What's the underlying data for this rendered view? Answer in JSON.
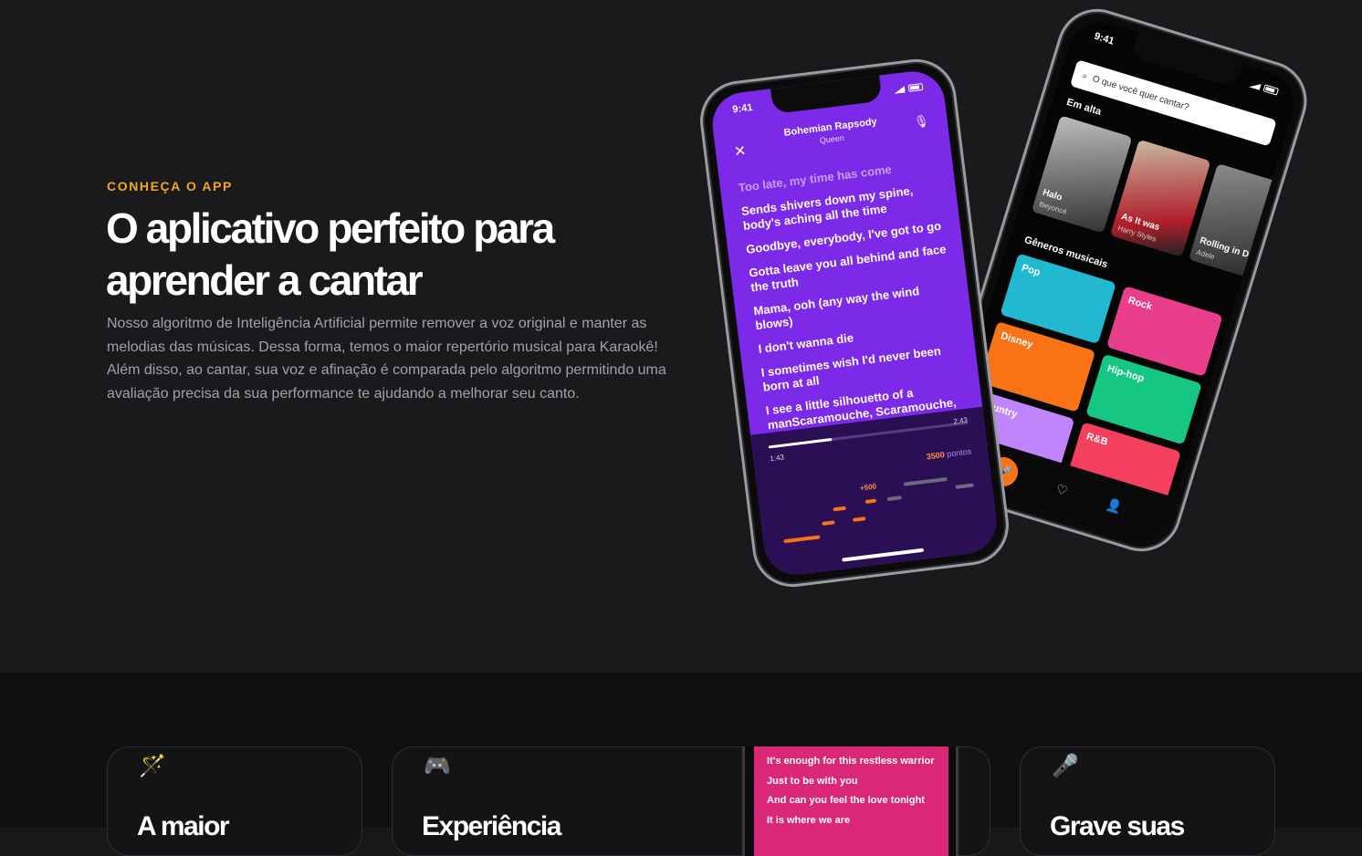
{
  "hero": {
    "eyebrow": "CONHEÇA O APP",
    "title": "O aplicativo perfeito para aprender a cantar",
    "description": "Nosso algoritmo de Inteligência Artificial permite remover a voz original e manter as melodias das músicas. Dessa forma, temos o maior repertório musical para Karaokê! Além disso, ao cantar, sua voz e afinação é comparada pelo algoritmo permitindo uma avaliação precisa da sua performance te ajudando a melhorar seu canto."
  },
  "phone_karaoke": {
    "time": "9:41",
    "song_title": "Bohemian Rapsody",
    "artist": "Queen",
    "lyrics_previous": "Too late, my time has come",
    "lyrics": [
      "Sends shivers down my spine, body's aching all the time",
      "Goodbye, everybody, I've got to go",
      "Gotta leave you all behind and face the truth",
      "Mama, ooh (any way the wind blows)",
      "I don't wanna die",
      "I sometimes wish I'd never been born at all",
      "I see a little silhouetto of a manScaramouche, Scaramouche,"
    ],
    "time_elapsed": "1:43",
    "time_total": "2:43",
    "progress_fraction": 0.32,
    "score_value": "3500",
    "score_unit": "pontos",
    "bonus": "+500"
  },
  "phone_browse": {
    "time": "9:41",
    "search_placeholder": "O que você quer cantar?",
    "trending_title": "Em alta",
    "trending": [
      {
        "title": "Halo",
        "artist": "Beyoncé"
      },
      {
        "title": "As It was",
        "artist": "Harry Styles"
      },
      {
        "title": "Rolling in Deep",
        "artist": "Adele"
      }
    ],
    "genres_title": "Gêneros musicais",
    "genres": [
      {
        "label": "Pop",
        "color": "#22b8cf"
      },
      {
        "label": "Rock",
        "color": "#e83e8c"
      },
      {
        "label": "Disney",
        "color": "#f97316"
      },
      {
        "label": "Hip-hop",
        "color": "#16c784"
      },
      {
        "label": "Country",
        "color": "#c084fc"
      },
      {
        "label": "R&B",
        "color": "#f43f5e"
      }
    ]
  },
  "features": {
    "card1_title": "A maior",
    "card2_title": "Experiência",
    "card3_title": "Grave suas",
    "pink_lyrics": [
      "It's enough for this restless warrior",
      "Just to be with you",
      "And can you feel the love tonight",
      "It is where we are"
    ]
  },
  "colors": {
    "accent": "#f5a524",
    "purple": "#7c2ae8",
    "orange": "#f97316",
    "pink": "#db2777"
  }
}
